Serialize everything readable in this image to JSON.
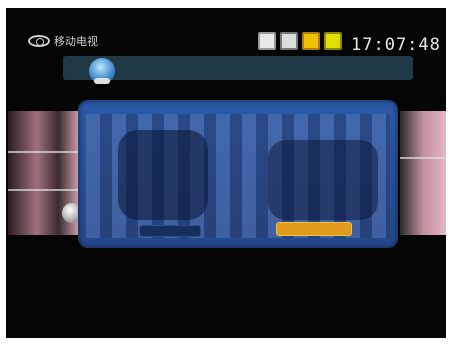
{
  "header": {
    "brand_label": "移动电视",
    "clock": "17:07:48"
  },
  "status_icons": [
    "disc-icon",
    "lock-icon",
    "mail-icon",
    "mail-alt-icon"
  ],
  "colors": {
    "panel": "#2c5aa8",
    "button_active": "#e09a1c",
    "button_inactive": "#16305e",
    "info_bar": "#1f3a46"
  }
}
